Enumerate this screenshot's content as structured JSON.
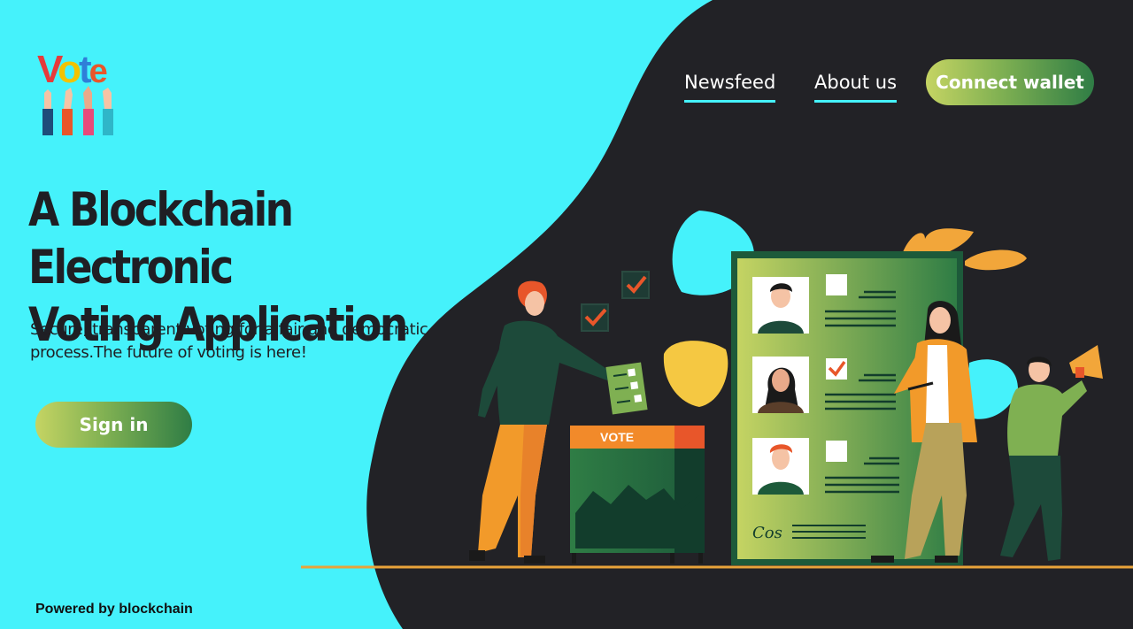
{
  "logo": {
    "letters": [
      "V",
      "o",
      "t",
      "e"
    ]
  },
  "nav": {
    "newsfeed_label": "Newsfeed",
    "about_label": "About us",
    "connect_wallet_label": "Connect wallet"
  },
  "hero": {
    "title_line1": "A Blockchain Electronic",
    "title_line2": "Voting Application",
    "subtitle": "Secure, transparent voting for a fair and democratic process.The future of voting is here!",
    "signin_label": "Sign in"
  },
  "illustration": {
    "ballot_box_label": "VOTE",
    "signature_text": "Cos"
  },
  "footer": {
    "powered_by": "Powered by blockchain"
  },
  "colors": {
    "background_cyan": "#45f2fb",
    "dark_blob": "#222226",
    "button_gradient_start": "#c5d463",
    "button_gradient_end": "#2f7d45",
    "title_text": "#1f1f24",
    "ground_line": "#e8a33a"
  }
}
